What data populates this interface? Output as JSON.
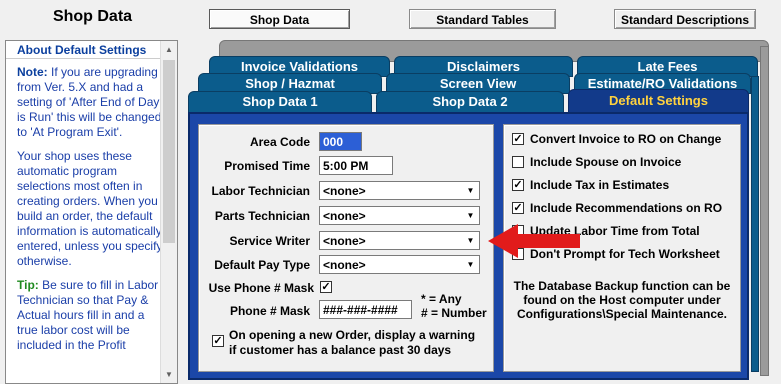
{
  "app": {
    "title": "Shop Data"
  },
  "top_buttons": [
    {
      "label": "Shop Data",
      "active": true
    },
    {
      "label": "Standard Tables"
    },
    {
      "label": "Standard Descriptions"
    }
  ],
  "help": {
    "heading": "About Default Settings",
    "note_label": "Note:",
    "note_text": " If you are upgrading from Ver. 5.X and had a setting of 'After End of Day is Run' this will be changed to 'At Program Exit'.",
    "para2": "Your shop uses these automatic program selections most often in creating orders. When you build an order, the default information is automatically entered, unless you specify otherwise.",
    "tip_label": "Tip:",
    "tip_text": " Be sure to fill in Labor Technician so that Pay & Actual hours fill in and a true labor cost will be included in the Profit"
  },
  "tabs": {
    "row1": [
      "Invoice Validations",
      "Disclaimers",
      "Late Fees"
    ],
    "row2": [
      "Shop / Hazmat",
      "Screen View",
      "Estimate/RO Validations"
    ],
    "row3": [
      "Shop Data 1",
      "Shop Data 2",
      "Default Settings"
    ]
  },
  "form": {
    "area_code_label": "Area Code",
    "area_code_value": "000",
    "promised_time_label": "Promised Time",
    "promised_time_value": "5:00 PM",
    "labor_tech_label": "Labor Technician",
    "labor_tech_value": "<none>",
    "parts_tech_label": "Parts Technician",
    "parts_tech_value": "<none>",
    "service_writer_label": "Service Writer",
    "service_writer_value": "<none>",
    "pay_type_label": "Default Pay Type",
    "pay_type_value": "<none>",
    "use_phone_mask_label": "Use Phone # Mask",
    "phone_mask_label": "Phone # Mask",
    "phone_mask_value": "###-###-####",
    "mask_hint_line1": "* = Any",
    "mask_hint_line2": "# = Number",
    "warning_label": "On opening a new Order, display a warning if customer has a balance past 30 days"
  },
  "options": [
    {
      "label": "Convert Invoice to RO on Change",
      "checked": true
    },
    {
      "label": "Include Spouse on Invoice",
      "checked": false
    },
    {
      "label": "Include Tax in Estimates",
      "checked": true
    },
    {
      "label": "Include Recommendations on RO",
      "checked": true
    },
    {
      "label": "Update Labor Time from Total",
      "checked": false
    },
    {
      "label": "Don't Prompt for Tech Worksheet",
      "checked": false
    }
  ],
  "backup_note": "The Database Backup function can be found on the Host computer under Configurations\\Special Maintenance.",
  "colors": {
    "tab_blue": "#0b5c8c",
    "active_tab": "#123a8a",
    "active_text": "#ffd23f",
    "arrow": "#e11b1b"
  }
}
